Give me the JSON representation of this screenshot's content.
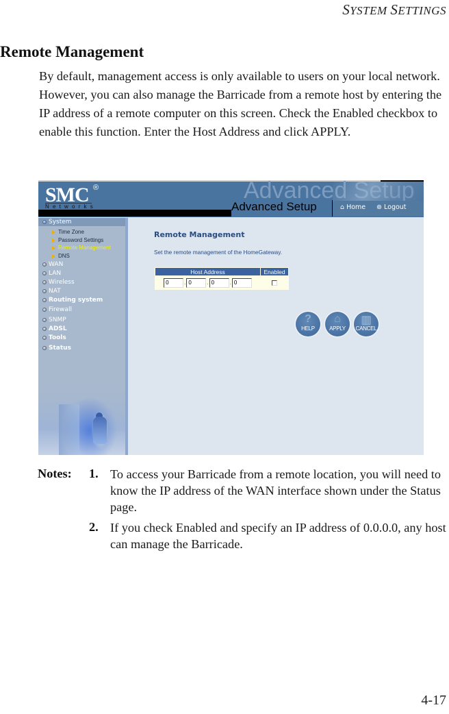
{
  "running_head": {
    "first": "S",
    "rest1": "YSTEM ",
    "second": "S",
    "rest2": "ETTINGS"
  },
  "section_title": "Remote Management",
  "intro": "By default, management access is only available to users on your local network. However, you can also manage the Barricade from a remote host by entering the IP address of a remote computer on this screen. Check the Enabled checkbox to enable this function. Enter the Host Address and click APPLY.",
  "screenshot": {
    "logo": {
      "brand": "SMC",
      "registered": "®",
      "tagline": "Networks"
    },
    "banner_watermark": "Advanced Setup",
    "banner_title": "Advanced Setup",
    "nav": {
      "home": "Home",
      "logout": "Logout",
      "home_icon": "house-icon",
      "logout_icon": "power-icon"
    },
    "sidebar": {
      "items": [
        {
          "label": "System",
          "active": true
        },
        {
          "label": "WAN"
        },
        {
          "label": "LAN"
        },
        {
          "label": "Wireless"
        },
        {
          "label": "NAT"
        },
        {
          "label": "Routing system"
        },
        {
          "label": "Firewall"
        },
        {
          "label": "SNMP"
        },
        {
          "label": "ADSL"
        },
        {
          "label": "Tools"
        },
        {
          "label": "Status"
        }
      ],
      "sub_items": [
        {
          "label": "Time Zone"
        },
        {
          "label": "Password Settings"
        },
        {
          "label": "Remote Management",
          "current": true
        },
        {
          "label": "DNS"
        }
      ]
    },
    "content": {
      "title": "Remote Management",
      "subtitle": "Set the remote management of the HomeGateway.",
      "table": {
        "headers": [
          "Host Address",
          "Enabled"
        ],
        "ip_octets": [
          "0",
          "0",
          "0",
          "0"
        ],
        "separator": ".",
        "enabled_checked": false
      },
      "buttons": {
        "help": "HELP",
        "apply": "APPLY",
        "cancel": "CANCEL"
      }
    },
    "colors": {
      "banner": "#4a74a0",
      "sidebar": "#a8b9cd",
      "content_bg": "#dde5ef",
      "table_header": "#3b62a0",
      "accent_text": "#2a4d80",
      "current_link": "#f3f000"
    }
  },
  "notes": {
    "label": "Notes:",
    "items": [
      {
        "num": "1.",
        "text": "To access your Barricade from a remote location, you will need to know the IP address of the WAN interface shown under the Status page."
      },
      {
        "num": "2.",
        "text": "If you check Enabled and specify an IP address of 0.0.0.0, any host can manage the Barricade."
      }
    ]
  },
  "page_number": "4-17"
}
